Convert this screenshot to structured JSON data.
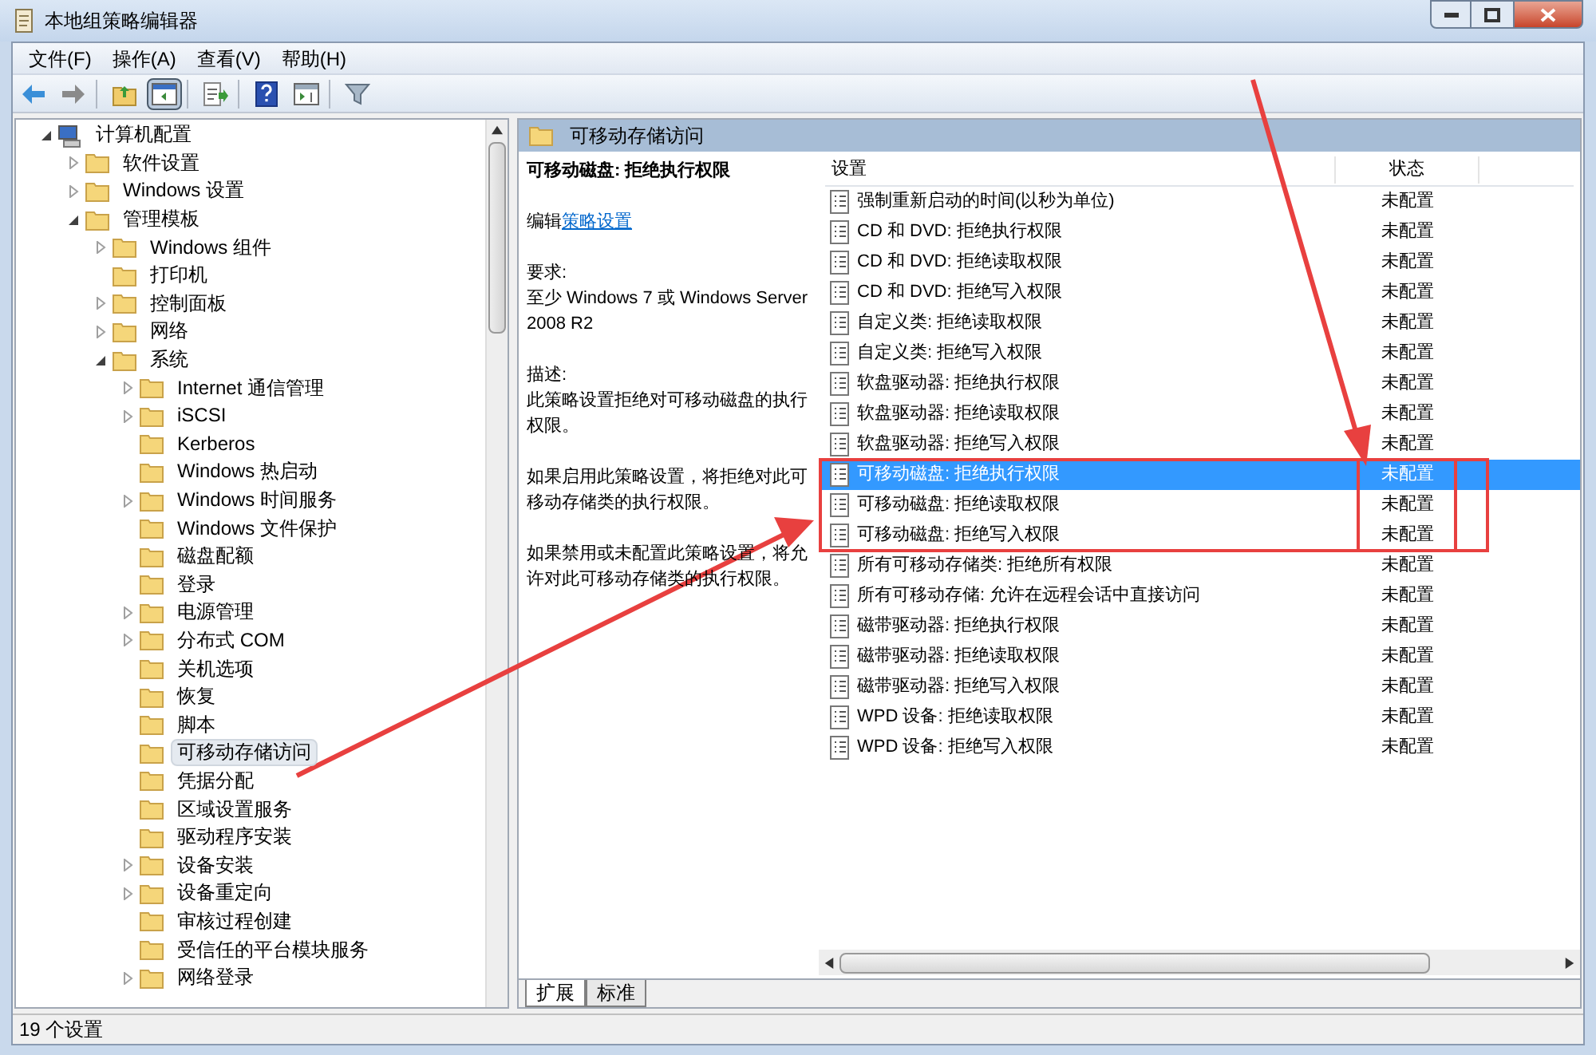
{
  "window": {
    "title": "本地组策略编辑器"
  },
  "menu": [
    "文件(F)",
    "操作(A)",
    "查看(V)",
    "帮助(H)"
  ],
  "toolbar": [
    [
      {
        "kind": "back",
        "pressed": false
      },
      {
        "kind": "forward",
        "pressed": false
      }
    ],
    [
      {
        "kind": "up",
        "pressed": false
      },
      {
        "kind": "tree",
        "pressed": true
      }
    ],
    [
      {
        "kind": "export",
        "pressed": false
      }
    ],
    [
      {
        "kind": "help",
        "pressed": false
      },
      {
        "kind": "panel",
        "pressed": false
      }
    ],
    [
      {
        "kind": "filter",
        "pressed": false
      }
    ]
  ],
  "tree": [
    {
      "label": "计算机配置",
      "kind": "computer",
      "expanded": true,
      "selected": false,
      "children": [
        {
          "label": "软件设置",
          "kind": "folder",
          "expanded": false,
          "selected": false
        },
        {
          "label": "Windows 设置",
          "kind": "folder",
          "expanded": false,
          "selected": false
        },
        {
          "label": "管理模板",
          "kind": "folder",
          "expanded": true,
          "selected": false,
          "children": [
            {
              "label": "Windows 组件",
              "kind": "folder",
              "expanded": false,
              "selected": false
            },
            {
              "label": "打印机",
              "kind": "folder",
              "selected": false
            },
            {
              "label": "控制面板",
              "kind": "folder",
              "expanded": false,
              "selected": false
            },
            {
              "label": "网络",
              "kind": "folder",
              "expanded": false,
              "selected": false
            },
            {
              "label": "系统",
              "kind": "folder",
              "expanded": true,
              "selected": false,
              "children": [
                {
                  "label": "Internet 通信管理",
                  "kind": "folder",
                  "expanded": false,
                  "selected": false
                },
                {
                  "label": "iSCSI",
                  "kind": "folder",
                  "expanded": false,
                  "selected": false
                },
                {
                  "label": "Kerberos",
                  "kind": "folder",
                  "selected": false
                },
                {
                  "label": "Windows 热启动",
                  "kind": "folder",
                  "selected": false
                },
                {
                  "label": "Windows 时间服务",
                  "kind": "folder",
                  "expanded": false,
                  "selected": false
                },
                {
                  "label": "Windows 文件保护",
                  "kind": "folder",
                  "selected": false
                },
                {
                  "label": "磁盘配额",
                  "kind": "folder",
                  "selected": false
                },
                {
                  "label": "登录",
                  "kind": "folder",
                  "selected": false
                },
                {
                  "label": "电源管理",
                  "kind": "folder",
                  "expanded": false,
                  "selected": false
                },
                {
                  "label": "分布式 COM",
                  "kind": "folder",
                  "expanded": false,
                  "selected": false
                },
                {
                  "label": "关机选项",
                  "kind": "folder",
                  "selected": false
                },
                {
                  "label": "恢复",
                  "kind": "folder",
                  "selected": false
                },
                {
                  "label": "脚本",
                  "kind": "folder",
                  "selected": false
                },
                {
                  "label": "可移动存储访问",
                  "kind": "folder",
                  "selected": true
                },
                {
                  "label": "凭据分配",
                  "kind": "folder",
                  "selected": false
                },
                {
                  "label": "区域设置服务",
                  "kind": "folder",
                  "selected": false
                },
                {
                  "label": "驱动程序安装",
                  "kind": "folder",
                  "selected": false
                },
                {
                  "label": "设备安装",
                  "kind": "folder",
                  "expanded": false,
                  "selected": false
                },
                {
                  "label": "设备重定向",
                  "kind": "folder",
                  "expanded": false,
                  "selected": false
                },
                {
                  "label": "审核过程创建",
                  "kind": "folder",
                  "selected": false
                },
                {
                  "label": "受信任的平台模块服务",
                  "kind": "folder",
                  "selected": false
                },
                {
                  "label": "网络登录",
                  "kind": "folder",
                  "expanded": false,
                  "selected": false
                }
              ]
            }
          ]
        }
      ]
    }
  ],
  "details": {
    "header": "可移动存储访问",
    "title": "可移动磁盘: 拒绝执行权限",
    "edit_prefix": "编辑",
    "edit_link": "策略设置",
    "requirement_label": "要求:",
    "requirement": "至少 Windows 7 或 Windows Server 2008 R2",
    "description_label": "描述:",
    "paragraphs": [
      "此策略设置拒绝对可移动磁盘的执行权限。",
      "如果启用此策略设置，将拒绝对此可移动存储类的执行权限。",
      "如果禁用或未配置此策略设置，将允许对此可移动存储类的执行权限。"
    ]
  },
  "list": {
    "columns": [
      "设置",
      "状态"
    ],
    "rows": [
      {
        "name": "强制重新启动的时间(以秒为单位)",
        "state": "未配置",
        "selected": false
      },
      {
        "name": "CD 和 DVD: 拒绝执行权限",
        "state": "未配置",
        "selected": false
      },
      {
        "name": "CD 和 DVD: 拒绝读取权限",
        "state": "未配置",
        "selected": false
      },
      {
        "name": "CD 和 DVD: 拒绝写入权限",
        "state": "未配置",
        "selected": false
      },
      {
        "name": "自定义类: 拒绝读取权限",
        "state": "未配置",
        "selected": false
      },
      {
        "name": "自定义类: 拒绝写入权限",
        "state": "未配置",
        "selected": false
      },
      {
        "name": "软盘驱动器: 拒绝执行权限",
        "state": "未配置",
        "selected": false
      },
      {
        "name": "软盘驱动器: 拒绝读取权限",
        "state": "未配置",
        "selected": false
      },
      {
        "name": "软盘驱动器: 拒绝写入权限",
        "state": "未配置",
        "selected": false
      },
      {
        "name": "可移动磁盘: 拒绝执行权限",
        "state": "未配置",
        "selected": true
      },
      {
        "name": "可移动磁盘: 拒绝读取权限",
        "state": "未配置",
        "selected": false
      },
      {
        "name": "可移动磁盘: 拒绝写入权限",
        "state": "未配置",
        "selected": false
      },
      {
        "name": "所有可移动存储类: 拒绝所有权限",
        "state": "未配置",
        "selected": false
      },
      {
        "name": "所有可移动存储: 允许在远程会话中直接访问",
        "state": "未配置",
        "selected": false
      },
      {
        "name": "磁带驱动器: 拒绝执行权限",
        "state": "未配置",
        "selected": false
      },
      {
        "name": "磁带驱动器: 拒绝读取权限",
        "state": "未配置",
        "selected": false
      },
      {
        "name": "磁带驱动器: 拒绝写入权限",
        "state": "未配置",
        "selected": false
      },
      {
        "name": "WPD 设备: 拒绝读取权限",
        "state": "未配置",
        "selected": false
      },
      {
        "name": "WPD 设备: 拒绝写入权限",
        "state": "未配置",
        "selected": false
      }
    ]
  },
  "tabs": [
    {
      "label": "扩展",
      "selected": true
    },
    {
      "label": "标准",
      "selected": false
    }
  ],
  "status_bar": "19 个设置"
}
